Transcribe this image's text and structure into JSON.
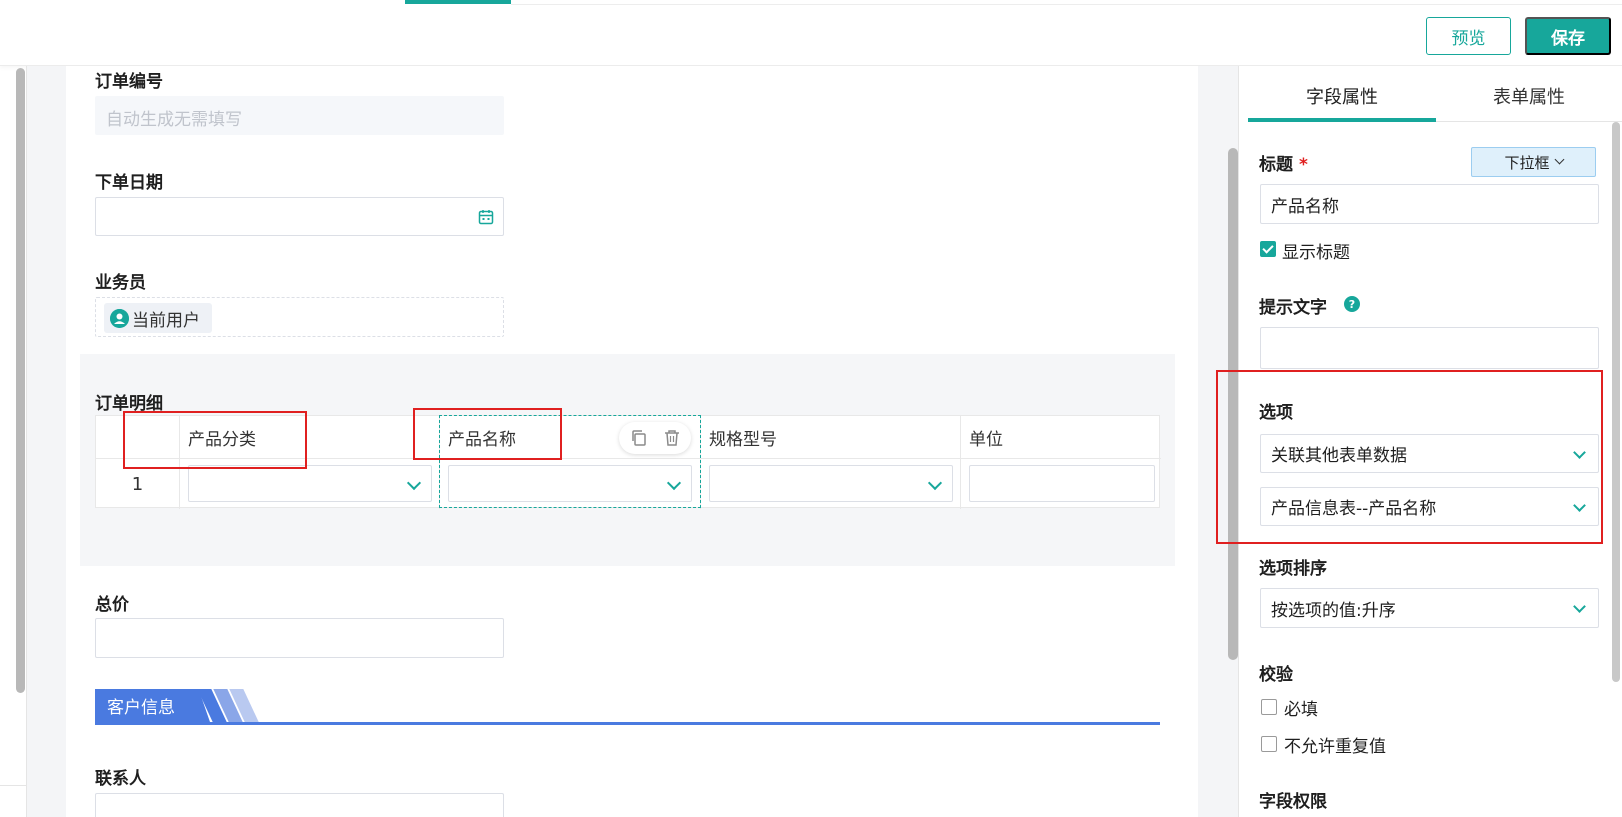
{
  "toolbar": {
    "preview_label": "预览",
    "save_label": "保存",
    "accent_color": "#17a79b"
  },
  "form": {
    "order_no": {
      "label": "订单编号",
      "placeholder": "自动生成无需填写"
    },
    "order_date": {
      "label": "下单日期",
      "icon": "calendar-icon"
    },
    "salesperson": {
      "label": "业务员",
      "value": "当前用户",
      "icon": "user-icon"
    },
    "details": {
      "label": "订单明细",
      "columns": [
        "产品分类",
        "产品名称",
        "规格型号",
        "单位"
      ],
      "rows": [
        {
          "no": "1"
        }
      ],
      "tools": [
        "copy-icon",
        "delete-icon"
      ]
    },
    "total_price": {
      "label": "总价"
    },
    "customer_group": {
      "title": "客户信息",
      "color": "#4a7ae0"
    },
    "contact": {
      "label": "联系人"
    }
  },
  "panel": {
    "tabs": [
      "字段属性",
      "表单属性"
    ],
    "active_tab": "字段属性",
    "title": {
      "label": "标题",
      "required_mark": "*",
      "type_button": "下拉框",
      "value": "产品名称"
    },
    "show_title": {
      "label": "显示标题",
      "checked": true
    },
    "hint": {
      "label": "提示文字",
      "help_icon": "?",
      "value": ""
    },
    "options": {
      "label": "选项",
      "source": "关联其他表单数据",
      "field": "产品信息表--产品名称"
    },
    "sort": {
      "label": "选项排序",
      "value": "按选项的值:升序"
    },
    "validation": {
      "label": "校验",
      "required_label": "必填",
      "required_checked": false,
      "no_duplicate_label": "不允许重复值",
      "no_duplicate_checked": false
    },
    "permissions": {
      "label": "字段权限"
    }
  },
  "annotation_color": "#e02020"
}
